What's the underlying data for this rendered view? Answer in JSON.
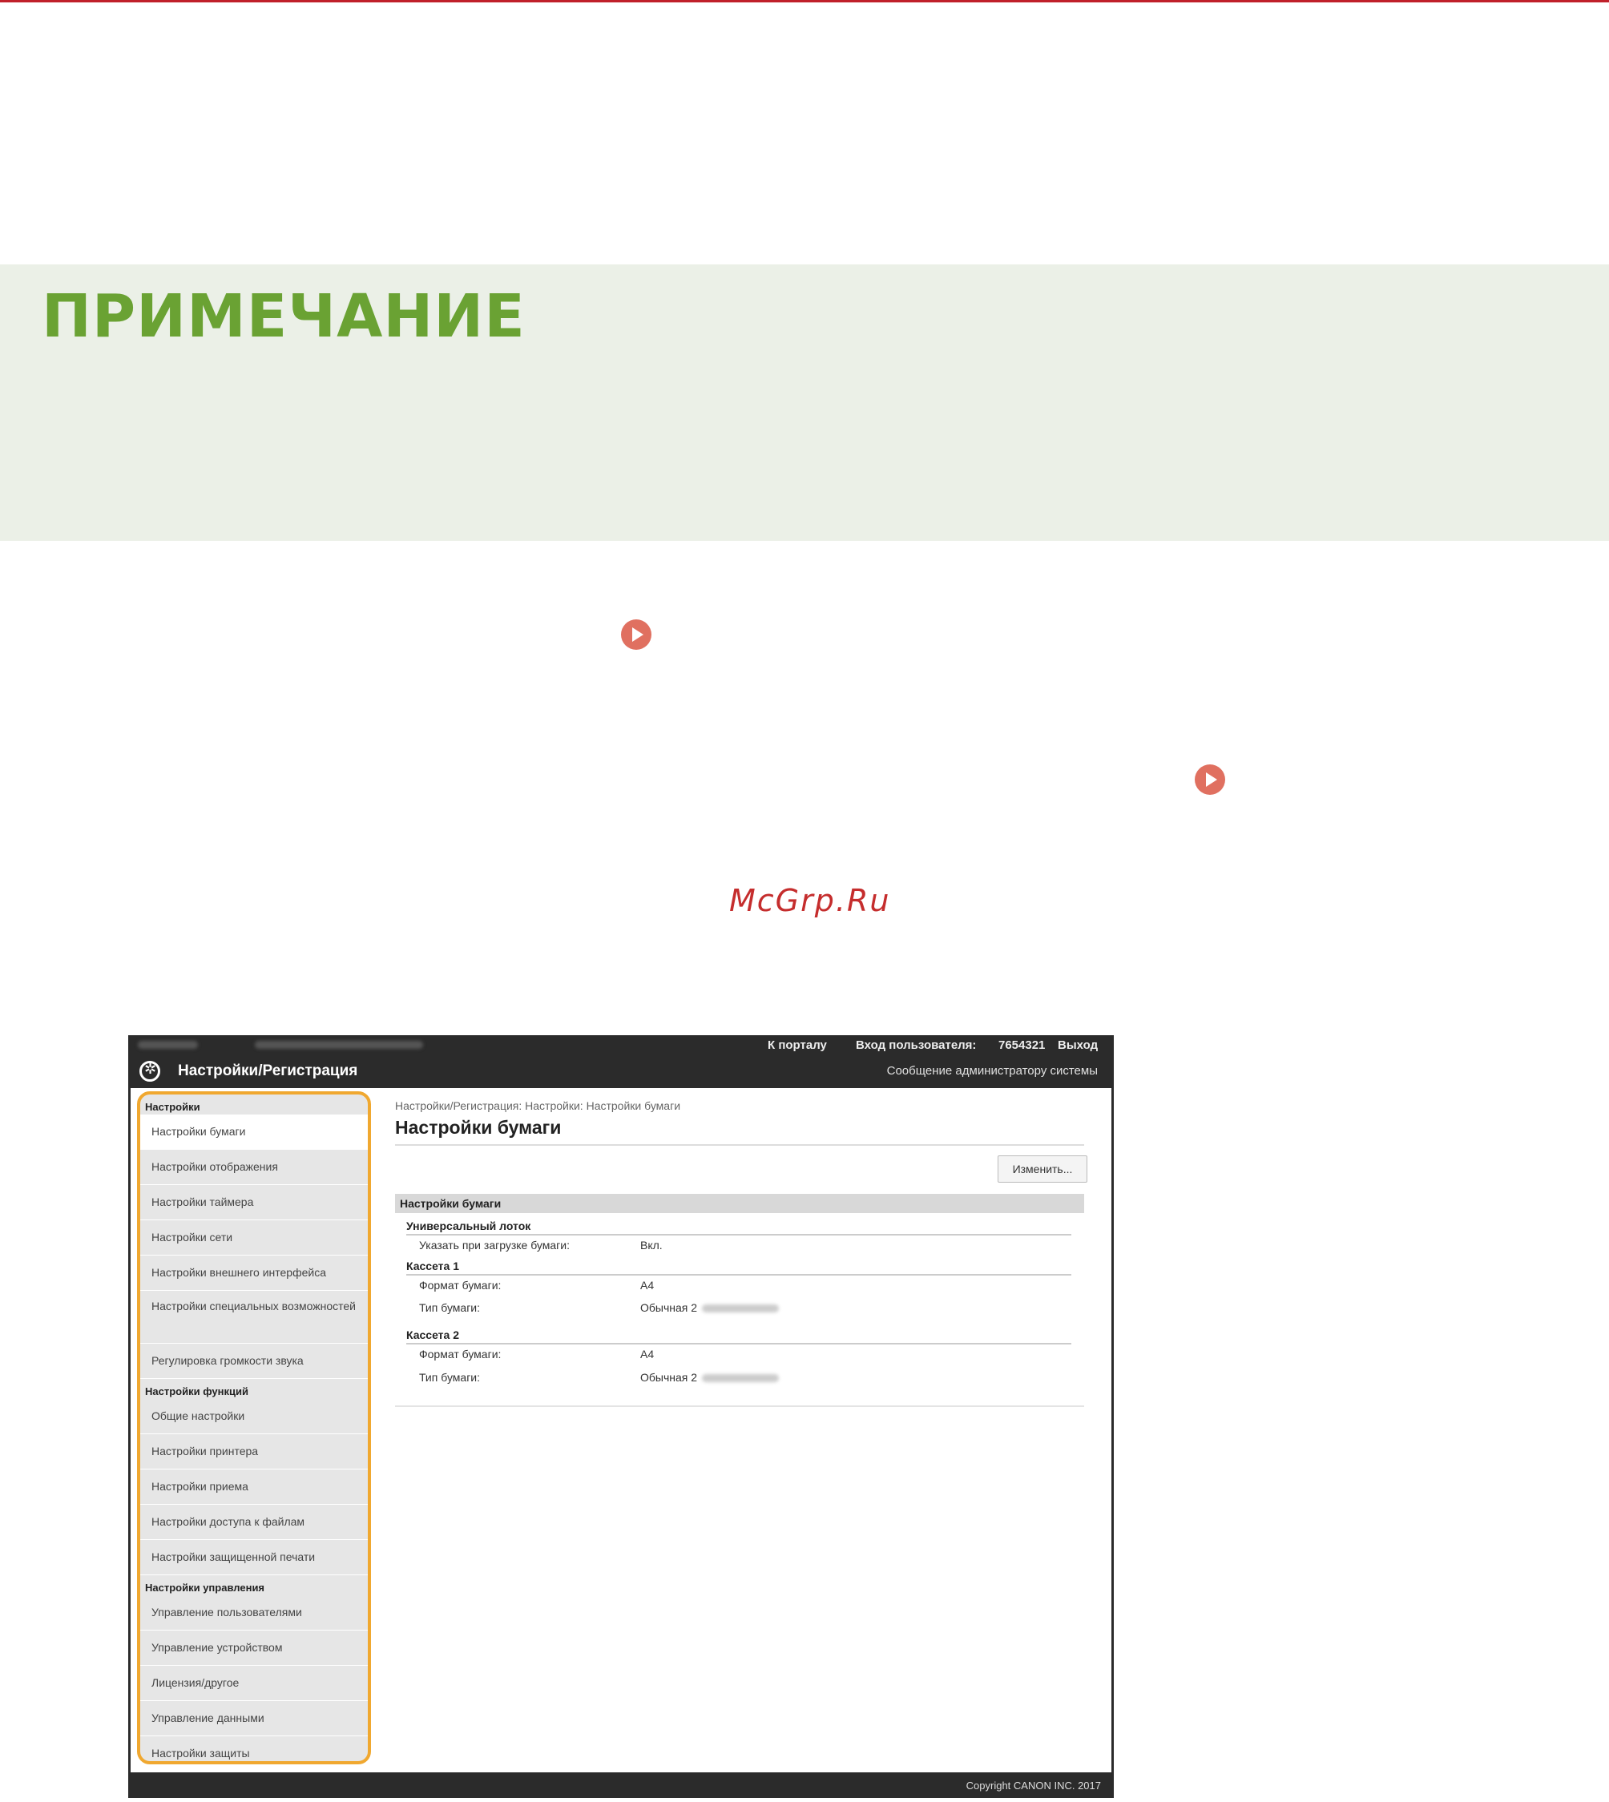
{
  "note": {
    "title": "ПРИМЕЧАНИЕ"
  },
  "watermark": "McGrp.Ru",
  "ui": {
    "topbar": {
      "portal": "К порталу",
      "login_label": "Вход пользователя:",
      "login_user": "7654321",
      "logout": "Выход"
    },
    "title": "Настройки/Регистрация",
    "admin_message": "Сообщение администратору системы",
    "sidebar": {
      "section1": "Настройки",
      "items1": [
        "Настройки бумаги",
        "Настройки отображения",
        "Настройки таймера",
        "Настройки сети",
        "Настройки внешнего интерфейса",
        "Настройки специальных возможностей",
        "Регулировка громкости звука"
      ],
      "section2": "Настройки функций",
      "items2": [
        "Общие настройки",
        "Настройки принтера",
        "Настройки приема",
        "Настройки доступа к файлам",
        "Настройки защищенной печати"
      ],
      "section3": "Настройки управления",
      "items3": [
        "Управление пользователями",
        "Управление устройством",
        "Лицензия/другое",
        "Управление данными",
        "Настройки защиты"
      ]
    },
    "main": {
      "breadcrumb": "Настройки/Регистрация: Настройки: Настройки бумаги",
      "page_title": "Настройки бумаги",
      "edit_button": "Изменить...",
      "section_title": "Настройки бумаги",
      "mp_tray": {
        "title": "Универсальный лоток",
        "label": "Указать при загрузке бумаги:",
        "value": "Вкл."
      },
      "cassette1": {
        "title": "Кассета 1",
        "size_label": "Формат бумаги:",
        "size_value": "A4",
        "type_label": "Тип бумаги:",
        "type_value": "Обычная 2"
      },
      "cassette2": {
        "title": "Кассета 2",
        "size_label": "Формат бумаги:",
        "size_value": "A4",
        "type_label": "Тип бумаги:",
        "type_value": "Обычная 2"
      }
    },
    "footer": "Copyright CANON INC. 2017"
  }
}
